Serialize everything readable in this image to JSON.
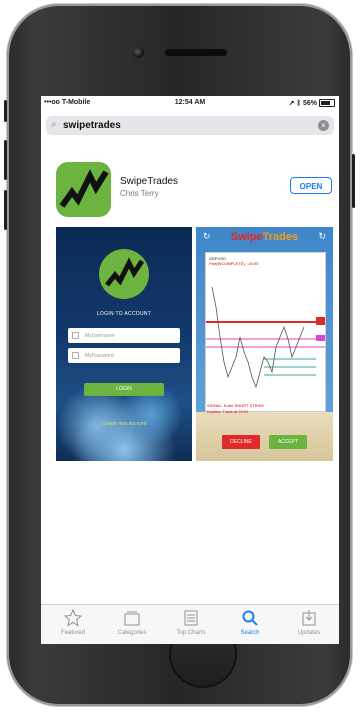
{
  "status_bar": {
    "carrier": "•••oo T-Mobile",
    "time": "12:54 AM",
    "battery": "56%"
  },
  "search": {
    "query": "swipetrades"
  },
  "app": {
    "name": "SwipeTrades",
    "developer": "Chris Terry",
    "action_label": "OPEN",
    "icon_color": "#6cb33f"
  },
  "screenshot1": {
    "title": "LOGIN TO ACCOUNT",
    "username_placeholder": "MyUsername",
    "password_placeholder": "MyPassword",
    "login_label": "LOGIN",
    "register_label": "Create new account"
  },
  "screenshot2": {
    "title_part1": "Swipe",
    "title_part2": "Trades",
    "chart_header": "GBPUSD",
    "chart_subheader": "Pair(INCOMPLETE) · 20:00",
    "signal_text": "SIGNAL: Enter SHORT STRIKE",
    "signal_subtext": "Expires: Trade at 20:00",
    "decline_label": "DECLINE",
    "accept_label": "ACCEPT"
  },
  "tabbar": {
    "items": [
      {
        "label": "Featured",
        "icon": "star-icon"
      },
      {
        "label": "Categories",
        "icon": "categories-icon"
      },
      {
        "label": "Top Charts",
        "icon": "list-icon"
      },
      {
        "label": "Search",
        "icon": "search-icon",
        "active": true
      },
      {
        "label": "Updates",
        "icon": "updates-icon"
      }
    ],
    "active_color": "#1a7cf5"
  }
}
